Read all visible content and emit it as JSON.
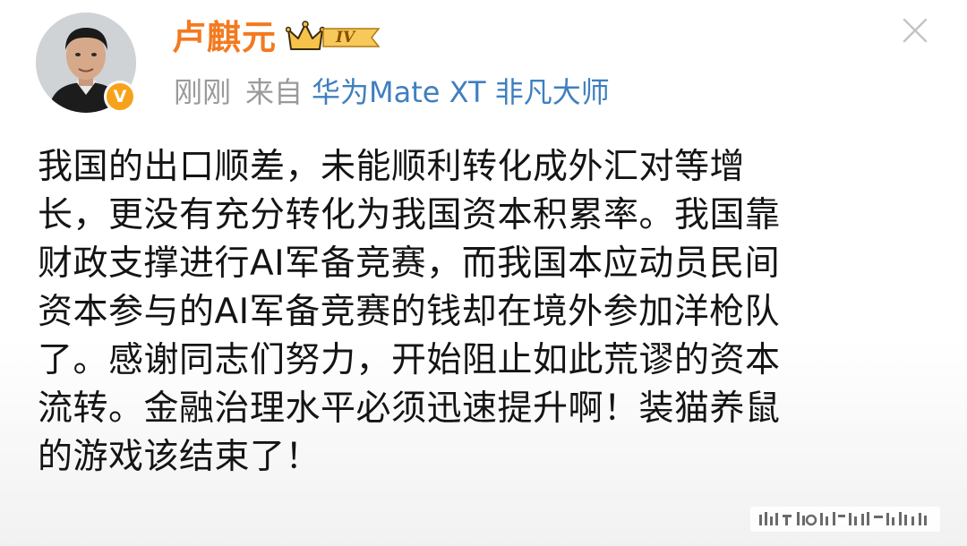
{
  "user": {
    "name": "卢麒元",
    "verified_mark": "V",
    "level": "IV"
  },
  "meta": {
    "time": "刚刚",
    "from_label": "来自",
    "device": "华为Mate XT 非凡大师"
  },
  "post": {
    "lines": [
      "我国的出口顺差，未能顺利转化成外汇对等增",
      "长，更没有充分转化为我国资本积累率。我国靠",
      "财政支撑进行AI军备竞赛，而我国本应动员民间",
      "资本参与的AI军备竞赛的钱却在境外参加洋枪队",
      "了。感谢同志们努力，开始阻止如此荒谬的资本",
      "流转。金融治理水平必须迅速提升啊！装猫养鼠",
      "的游戏该结束了！"
    ]
  },
  "colors": {
    "username": "#f37a1f",
    "meta_gray": "#9a9a9a",
    "device_link": "#3f7fbf",
    "verified_badge": "#f7a21b",
    "body_text": "#141414"
  },
  "icons": {
    "close": "close-icon",
    "crown": "crown-icon",
    "verified": "verified-badge-icon"
  }
}
